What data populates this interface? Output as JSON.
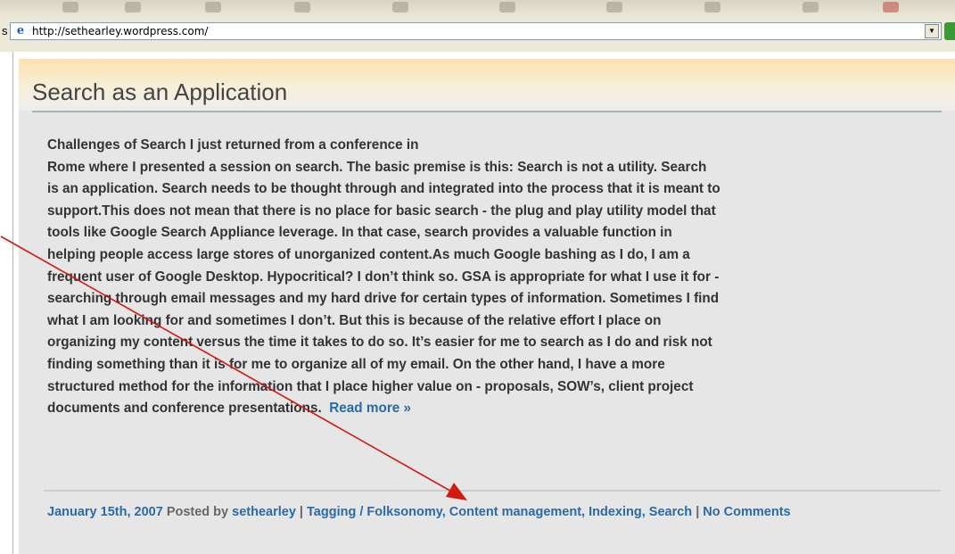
{
  "browser": {
    "address_label": "s",
    "url": "http://sethearley.wordpress.com/"
  },
  "post": {
    "title": "Search as an Application",
    "body_lines": [
      "Challenges of Search I just returned from a conference in",
      "Rome where I presented a session on search.  The basic premise is this:  Search is not a utility.  Search",
      "is an application.  Search needs to be thought through and integrated into the process that it is meant to",
      "support.This does not mean that there is no place for basic search - the plug and play utility model that",
      "tools like Google Search Appliance leverage.  In that case, search provides a valuable function in",
      "helping people access large stores of unorganized content.As much Google bashing as I do, I am a",
      "frequent user of Google Desktop.  Hypocritical?  I don’t think so.  GSA is appropriate for what I use it for -",
      "searching through email messages and my hard drive for certain types of information.  Sometimes I find",
      "what I am looking for and sometimes I don’t.  But this is because of the relative effort I place on",
      "organizing my content versus the time it takes to do so.  It’s easier for me to search as I do and risk not",
      "finding something than it is for me to organize all of my email. On the other hand, I have a more",
      "structured method for the information that I place higher value on - proposals, SOW’s, client project",
      "documents and conference presentations."
    ],
    "read_more": "Read more »",
    "meta": {
      "date": "January 15th, 2007",
      "posted_by": "Posted by",
      "author": "sethearley",
      "sep1": "|",
      "category1": "Tagging / Folksonomy",
      "category2": "Content management",
      "category3": "Indexing",
      "category4": "Search",
      "sep2": "|",
      "comments": "No Comments"
    }
  },
  "colors": {
    "link": "#2a6aa6",
    "annotation_arrow": "#d21a0f",
    "header_gradient_top": "#fde2ad"
  }
}
